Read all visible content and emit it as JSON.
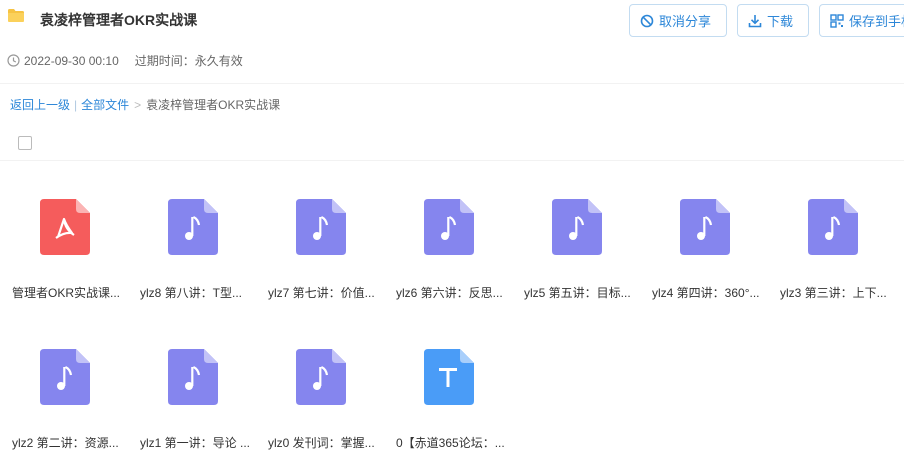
{
  "header": {
    "title": "袁凌梓管理者OKR实战课",
    "cancel_share_label": "取消分享",
    "download_label": "下载",
    "save_label": "保存到手机"
  },
  "meta": {
    "date": "2022-09-30 00:10",
    "expire": "过期时间：永久有效"
  },
  "breadcrumb": {
    "back": "返回上一级",
    "all_files": "全部文件",
    "current": "袁凌梓管理者OKR实战课"
  },
  "colors": {
    "pdf": "#f55c5c",
    "audio": "#8585ee",
    "text": "#4a9cf7",
    "link": "#2d87d8"
  },
  "files": [
    {
      "name": "管理者OKR实战课...",
      "type": "pdf-icon"
    },
    {
      "name": "ylz8 第八讲：T型...",
      "type": "audio-icon"
    },
    {
      "name": "ylz7 第七讲：价值...",
      "type": "audio-icon"
    },
    {
      "name": "ylz6 第六讲：反思...",
      "type": "audio-icon"
    },
    {
      "name": "ylz5 第五讲：目标...",
      "type": "audio-icon"
    },
    {
      "name": "ylz4 第四讲：360°...",
      "type": "audio-icon"
    },
    {
      "name": "ylz3 第三讲：上下...",
      "type": "audio-icon"
    },
    {
      "name": "ylz2 第二讲：资源...",
      "type": "audio-icon"
    },
    {
      "name": "ylz1 第一讲：导论 ...",
      "type": "audio-icon"
    },
    {
      "name": "ylz0 发刊词：掌握...",
      "type": "audio-icon"
    },
    {
      "name": "0【赤道365论坛：...",
      "type": "text-icon"
    }
  ]
}
